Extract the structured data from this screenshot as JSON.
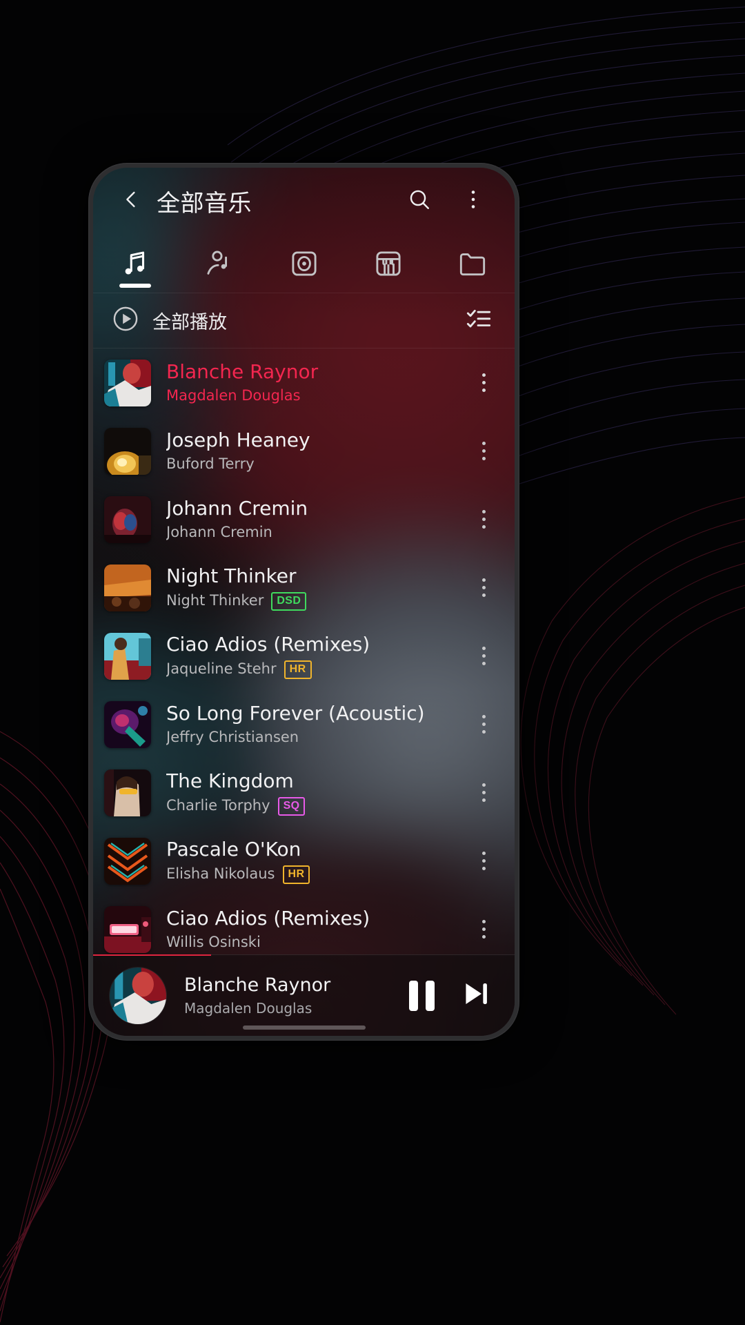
{
  "appbar": {
    "title": "全部音乐",
    "back_icon": "chevron-left-icon",
    "search_icon": "search-icon",
    "overflow_icon": "more-vertical-icon"
  },
  "tabs": [
    {
      "name": "songs",
      "icon": "music-note-icon",
      "active": true
    },
    {
      "name": "artists",
      "icon": "artist-icon",
      "active": false
    },
    {
      "name": "albums",
      "icon": "album-disc-icon",
      "active": false
    },
    {
      "name": "genres",
      "icon": "piano-icon",
      "active": false
    },
    {
      "name": "folders",
      "icon": "folder-icon",
      "active": false
    }
  ],
  "play_all": {
    "label": "全部播放",
    "play_icon": "play-circle-icon",
    "multiselect_icon": "checklist-icon"
  },
  "songs": [
    {
      "title": "Blanche Raynor",
      "artist": "Magdalen Douglas",
      "badge": "",
      "playing": true
    },
    {
      "title": "Joseph Heaney",
      "artist": "Buford Terry",
      "badge": "",
      "playing": false
    },
    {
      "title": "Johann Cremin",
      "artist": "Johann Cremin",
      "badge": "",
      "playing": false
    },
    {
      "title": "Night Thinker",
      "artist": "Night Thinker",
      "badge": "DSD",
      "playing": false
    },
    {
      "title": "Ciao Adios (Remixes)",
      "artist": "Jaqueline Stehr",
      "badge": "HR",
      "playing": false
    },
    {
      "title": "So Long Forever (Acoustic)",
      "artist": "Jeffry Christiansen",
      "badge": "",
      "playing": false
    },
    {
      "title": "The Kingdom",
      "artist": "Charlie Torphy",
      "badge": "SQ",
      "playing": false
    },
    {
      "title": "Pascale O'Kon",
      "artist": "Elisha Nikolaus",
      "badge": "HR",
      "playing": false
    },
    {
      "title": "Ciao Adios (Remixes)",
      "artist": "Willis Osinski",
      "badge": "",
      "playing": false
    }
  ],
  "now_playing": {
    "title": "Blanche Raynor",
    "artist": "Magdalen Douglas",
    "pause_icon": "pause-icon",
    "next_icon": "skip-next-icon",
    "progress_percent": 28
  },
  "colors": {
    "accent": "#f3264f",
    "badge_dsd": "#3fdb5e",
    "badge_hr": "#f0b42c",
    "badge_sq": "#e85ae8",
    "text_primary": "#f1f1f2",
    "text_secondary": "#b9b9bb"
  }
}
